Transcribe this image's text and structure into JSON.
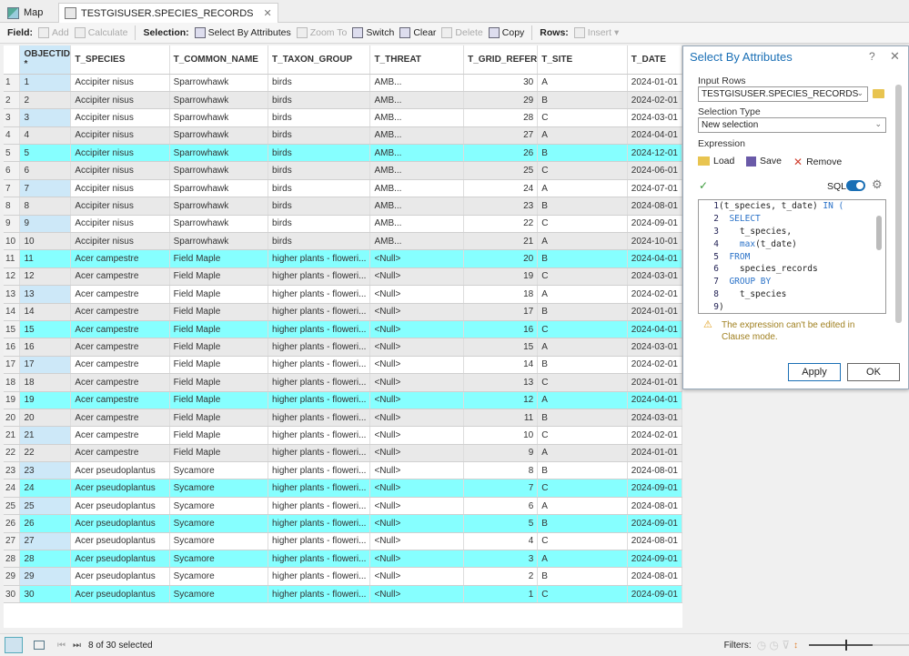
{
  "tabs": [
    {
      "label": "Map",
      "icon": "map-icon"
    },
    {
      "label": "TESTGISUSER.SPECIES_RECORDS",
      "icon": "table-icon"
    }
  ],
  "toolbar": {
    "field_label": "Field:",
    "add": "Add",
    "calculate": "Calculate",
    "selection_label": "Selection:",
    "select_by_attributes": "Select By Attributes",
    "zoom_to": "Zoom To",
    "switch": "Switch",
    "clear": "Clear",
    "delete": "Delete",
    "copy": "Copy",
    "rows_label": "Rows:",
    "insert": "Insert"
  },
  "table": {
    "columns": [
      "OBJECTID *",
      "T_SPECIES",
      "T_COMMON_NAME",
      "T_TAXON_GROUP",
      "T_THREAT",
      "T_GRID_REFER",
      "T_SITE",
      "T_DATE"
    ],
    "selected_ids": [
      5,
      11,
      15,
      19,
      24,
      26,
      28,
      30
    ],
    "rows": [
      [
        1,
        "Accipiter nisus",
        "Sparrowhawk",
        "birds",
        "AMB...",
        30,
        "A",
        "2024-01-01"
      ],
      [
        2,
        "Accipiter nisus",
        "Sparrowhawk",
        "birds",
        "AMB...",
        29,
        "B",
        "2024-02-01"
      ],
      [
        3,
        "Accipiter nisus",
        "Sparrowhawk",
        "birds",
        "AMB...",
        28,
        "C",
        "2024-03-01"
      ],
      [
        4,
        "Accipiter nisus",
        "Sparrowhawk",
        "birds",
        "AMB...",
        27,
        "A",
        "2024-04-01"
      ],
      [
        5,
        "Accipiter nisus",
        "Sparrowhawk",
        "birds",
        "AMB...",
        26,
        "B",
        "2024-12-01"
      ],
      [
        6,
        "Accipiter nisus",
        "Sparrowhawk",
        "birds",
        "AMB...",
        25,
        "C",
        "2024-06-01"
      ],
      [
        7,
        "Accipiter nisus",
        "Sparrowhawk",
        "birds",
        "AMB...",
        24,
        "A",
        "2024-07-01"
      ],
      [
        8,
        "Accipiter nisus",
        "Sparrowhawk",
        "birds",
        "AMB...",
        23,
        "B",
        "2024-08-01"
      ],
      [
        9,
        "Accipiter nisus",
        "Sparrowhawk",
        "birds",
        "AMB...",
        22,
        "C",
        "2024-09-01"
      ],
      [
        10,
        "Accipiter nisus",
        "Sparrowhawk",
        "birds",
        "AMB...",
        21,
        "A",
        "2024-10-01"
      ],
      [
        11,
        "Acer campestre",
        "Field Maple",
        "higher plants - floweri...",
        "<Null>",
        20,
        "B",
        "2024-04-01"
      ],
      [
        12,
        "Acer campestre",
        "Field Maple",
        "higher plants - floweri...",
        "<Null>",
        19,
        "C",
        "2024-03-01"
      ],
      [
        13,
        "Acer campestre",
        "Field Maple",
        "higher plants - floweri...",
        "<Null>",
        18,
        "A",
        "2024-02-01"
      ],
      [
        14,
        "Acer campestre",
        "Field Maple",
        "higher plants - floweri...",
        "<Null>",
        17,
        "B",
        "2024-01-01"
      ],
      [
        15,
        "Acer campestre",
        "Field Maple",
        "higher plants - floweri...",
        "<Null>",
        16,
        "C",
        "2024-04-01"
      ],
      [
        16,
        "Acer campestre",
        "Field Maple",
        "higher plants - floweri...",
        "<Null>",
        15,
        "A",
        "2024-03-01"
      ],
      [
        17,
        "Acer campestre",
        "Field Maple",
        "higher plants - floweri...",
        "<Null>",
        14,
        "B",
        "2024-02-01"
      ],
      [
        18,
        "Acer campestre",
        "Field Maple",
        "higher plants - floweri...",
        "<Null>",
        13,
        "C",
        "2024-01-01"
      ],
      [
        19,
        "Acer campestre",
        "Field Maple",
        "higher plants - floweri...",
        "<Null>",
        12,
        "A",
        "2024-04-01"
      ],
      [
        20,
        "Acer campestre",
        "Field Maple",
        "higher plants - floweri...",
        "<Null>",
        11,
        "B",
        "2024-03-01"
      ],
      [
        21,
        "Acer campestre",
        "Field Maple",
        "higher plants - floweri...",
        "<Null>",
        10,
        "C",
        "2024-02-01"
      ],
      [
        22,
        "Acer campestre",
        "Field Maple",
        "higher plants - floweri...",
        "<Null>",
        9,
        "A",
        "2024-01-01"
      ],
      [
        23,
        "Acer pseudoplantus",
        "Sycamore",
        "higher plants - floweri...",
        "<Null>",
        8,
        "B",
        "2024-08-01"
      ],
      [
        24,
        "Acer pseudoplantus",
        "Sycamore",
        "higher plants - floweri...",
        "<Null>",
        7,
        "C",
        "2024-09-01"
      ],
      [
        25,
        "Acer pseudoplantus",
        "Sycamore",
        "higher plants - floweri...",
        "<Null>",
        6,
        "A",
        "2024-08-01"
      ],
      [
        26,
        "Acer pseudoplantus",
        "Sycamore",
        "higher plants - floweri...",
        "<Null>",
        5,
        "B",
        "2024-09-01"
      ],
      [
        27,
        "Acer pseudoplantus",
        "Sycamore",
        "higher plants - floweri...",
        "<Null>",
        4,
        "C",
        "2024-08-01"
      ],
      [
        28,
        "Acer pseudoplantus",
        "Sycamore",
        "higher plants - floweri...",
        "<Null>",
        3,
        "A",
        "2024-09-01"
      ],
      [
        29,
        "Acer pseudoplantus",
        "Sycamore",
        "higher plants - floweri...",
        "<Null>",
        2,
        "B",
        "2024-08-01"
      ],
      [
        30,
        "Acer pseudoplantus",
        "Sycamore",
        "higher plants - floweri...",
        "<Null>",
        1,
        "C",
        "2024-09-01"
      ]
    ]
  },
  "dialog": {
    "title": "Select By Attributes",
    "help": "?",
    "close": "✕",
    "input_rows_label": "Input Rows",
    "input_rows_value": "TESTGISUSER.SPECIES_RECORDS",
    "selection_type_label": "Selection Type",
    "selection_type_value": "New selection",
    "expression_label": "Expression",
    "load": "Load",
    "save": "Save",
    "remove": "Remove",
    "sql_label": "SQL",
    "sql_on": true,
    "code_lines": [
      {
        "n": "1",
        "t": "(t_species, t_date) ",
        "k": "IN ("
      },
      {
        "n": "2",
        "t": "  ",
        "k": "SELECT"
      },
      {
        "n": "3",
        "t": "    t_species,",
        "k": ""
      },
      {
        "n": "4",
        "t": "    ",
        "k": "max",
        "r": "(t_date)"
      },
      {
        "n": "5",
        "t": "  ",
        "k": "FROM"
      },
      {
        "n": "6",
        "t": "    species_records",
        "k": ""
      },
      {
        "n": "7",
        "t": "  ",
        "k": "GROUP BY"
      },
      {
        "n": "8",
        "t": "    t_species",
        "k": ""
      },
      {
        "n": "9",
        "t": ")",
        "k": ""
      }
    ],
    "warning": "The expression can't be edited in Clause mode.",
    "apply": "Apply",
    "ok": "OK"
  },
  "status": {
    "selected_text": "8 of 30 selected",
    "filters_label": "Filters:"
  },
  "colors": {
    "selected_row": "#86ffff",
    "accent": "#1a6fb5"
  }
}
